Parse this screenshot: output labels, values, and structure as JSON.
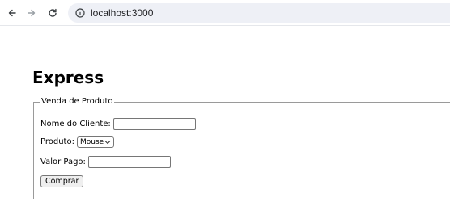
{
  "browser": {
    "url": "localhost:3000",
    "icons": {
      "back": "arrow-left",
      "forward": "arrow-right",
      "reload": "reload",
      "site_info": "info-circle"
    }
  },
  "page": {
    "title": "Express"
  },
  "form": {
    "legend": "Venda de Produto",
    "nome_label": "Nome do Cliente:",
    "nome_value": "",
    "produto_label": "Produto:",
    "produto_selected": "Mouse",
    "valor_label": "Valor Pago:",
    "valor_value": "",
    "submit_label": "Comprar"
  }
}
